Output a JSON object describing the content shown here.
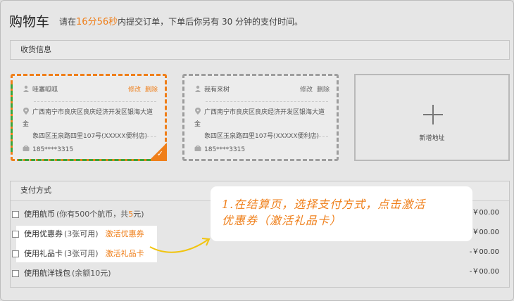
{
  "header": {
    "title": "购物车",
    "notice_prefix": "请在",
    "minutes": "16分",
    "seconds": "56秒",
    "notice_suffix": "内提交订单，下单后你另有 30 分钟的支付时间。"
  },
  "shipping": {
    "section_title": "收货信息",
    "addresses": [
      {
        "name": "哇塞呱呱",
        "edit": "修改",
        "delete": "删除",
        "address": "广西南宁市良庆区良庆经济开发区银海大道金象四区玉泉路四里107号(XXXXX便利店)",
        "address_line1": "广西南宁市良庆区良庆经济开发区银海大道金",
        "address_line2": "象四区玉泉路四里107号(XXXXX便利店)",
        "phone": "185****3315",
        "selected": true
      },
      {
        "name": "我有来树",
        "edit": "修改",
        "delete": "删除",
        "address_line1": "广西南宁市良庆区良庆经济开发区银海大道金",
        "address_line2": "象四区玉泉路四里107号(XXXXX便利店)",
        "phone": "185****3315",
        "selected": false
      }
    ],
    "new_address_label": "新增地址"
  },
  "payment": {
    "section_title": "支付方式",
    "options": [
      {
        "label": "使用航币",
        "detail": "(你有500个航币，共",
        "detail_amount": "5",
        "detail_end": "元)",
        "price": "￥00.00"
      },
      {
        "label": "使用优惠券",
        "detail": "(3张可用)",
        "action": "激活优惠券",
        "price": "-￥00.00"
      },
      {
        "label": "使用礼品卡",
        "detail": "(3张可用)",
        "action": "激活礼品卡",
        "price": "-￥00.00"
      },
      {
        "label": "使用航洋钱包",
        "detail": "(余额10元)",
        "price": "-￥00.00"
      }
    ]
  },
  "tooltip": {
    "line1": "1.在结算页，选择支付方式，点击激活",
    "line2": "优惠券（激活礼品卡）"
  },
  "colors": {
    "accent": "#ef7f1a",
    "green": "#3aa63a"
  }
}
